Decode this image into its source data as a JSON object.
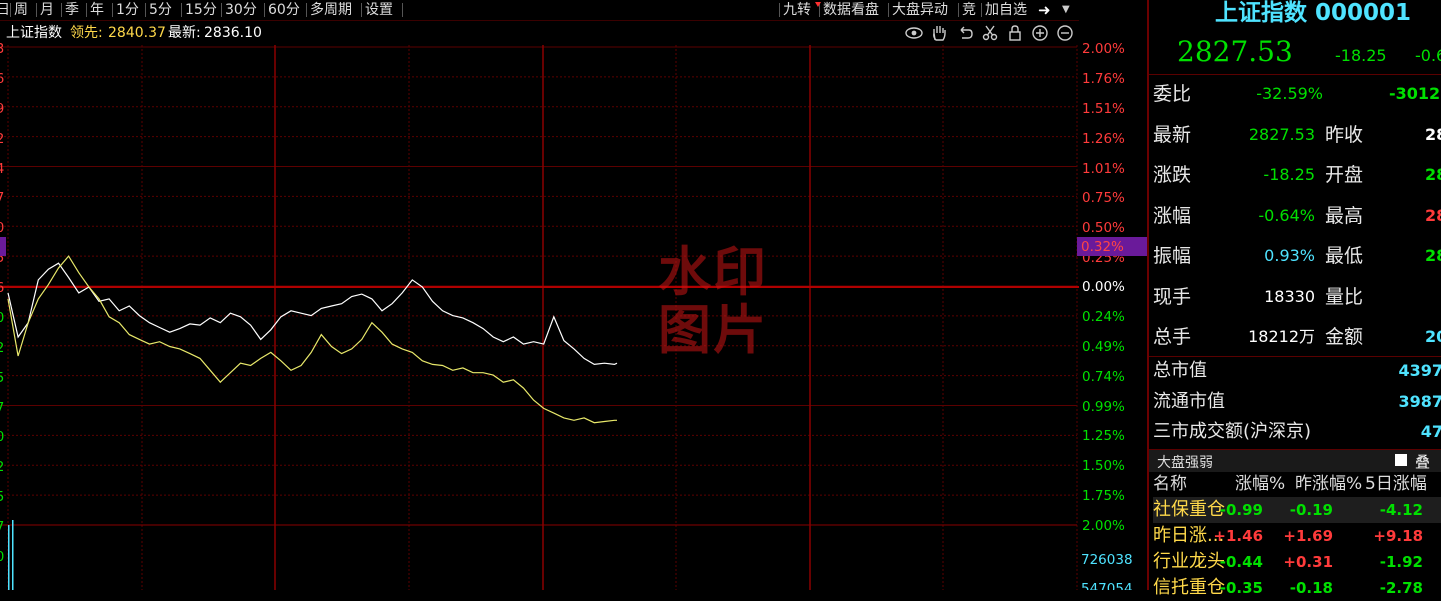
{
  "toolbar": {
    "left": [
      "日",
      "周",
      "月",
      "季",
      "年",
      "1分",
      "5分",
      "15分",
      "30分",
      "60分",
      "多周期",
      "设置"
    ],
    "right": [
      "九转",
      "数据看盘",
      "大盘异动",
      "竞",
      "加自选"
    ]
  },
  "info": {
    "name": "上证指数",
    "lead_label": "领先:",
    "lead_value": "2840.37",
    "latest_label": "最新:",
    "latest_value": "2836.10"
  },
  "y_axis": {
    "upper": [
      "2.00%",
      "1.76%",
      "1.51%",
      "1.26%",
      "1.01%",
      "0.75%",
      "0.50%",
      "0.25%"
    ],
    "highlight": "0.32%",
    "zero": "0.00%",
    "lower": [
      "0.24%",
      "0.49%",
      "0.74%",
      "0.99%",
      "1.25%",
      "1.50%",
      "1.75%",
      "2.00%"
    ],
    "volume_top": "726038",
    "volume_bottom": "547054"
  },
  "left_axis_digits": [
    "3",
    "6",
    "9",
    "2",
    "4",
    "7",
    "0",
    "5",
    "6",
    "0",
    "2",
    "5",
    "7",
    "0",
    "2",
    "5",
    "7",
    "0"
  ],
  "watermark": [
    "水印",
    "图片"
  ],
  "chart_data": {
    "type": "line",
    "title": "",
    "xlabel": "",
    "ylabel": "",
    "ylim": [
      -2.0,
      2.0
    ],
    "series": [
      {
        "name": "最新",
        "color": "#ffffff",
        "x": [
          0,
          4,
          8,
          12,
          16,
          20,
          24,
          28,
          32,
          36,
          40,
          44,
          48,
          52,
          56,
          60,
          64,
          68,
          72,
          76,
          80,
          84,
          88,
          92,
          96,
          100,
          104,
          108,
          112,
          116,
          120,
          124,
          128,
          132,
          136,
          140,
          144,
          148,
          152,
          156,
          160,
          164,
          168,
          172,
          176,
          180,
          184,
          188,
          192,
          196,
          200,
          204,
          208,
          212,
          216,
          220,
          224,
          228,
          232,
          236,
          240,
          241
        ],
        "values": [
          -0.05,
          -0.42,
          -0.3,
          0.06,
          0.15,
          0.2,
          0.08,
          -0.05,
          0.0,
          -0.12,
          -0.1,
          -0.2,
          -0.16,
          -0.24,
          -0.3,
          -0.34,
          -0.38,
          -0.35,
          -0.31,
          -0.32,
          -0.26,
          -0.3,
          -0.22,
          -0.25,
          -0.32,
          -0.44,
          -0.36,
          -0.25,
          -0.2,
          -0.22,
          -0.24,
          -0.18,
          -0.16,
          -0.14,
          -0.08,
          -0.06,
          -0.1,
          -0.2,
          -0.14,
          -0.05,
          0.06,
          0.0,
          -0.12,
          -0.2,
          -0.24,
          -0.26,
          -0.3,
          -0.35,
          -0.42,
          -0.46,
          -0.42,
          -0.48,
          -0.46,
          -0.48,
          -0.25,
          -0.45,
          -0.52,
          -0.6,
          -0.65,
          -0.64,
          -0.65,
          -0.64
        ]
      },
      {
        "name": "领先",
        "color": "#e8e86a",
        "x": [
          0,
          4,
          8,
          12,
          16,
          20,
          24,
          28,
          32,
          36,
          40,
          44,
          48,
          52,
          56,
          60,
          64,
          68,
          72,
          76,
          80,
          84,
          88,
          92,
          96,
          100,
          104,
          108,
          112,
          116,
          120,
          124,
          128,
          132,
          136,
          140,
          144,
          148,
          152,
          156,
          160,
          164,
          168,
          172,
          176,
          180,
          184,
          188,
          192,
          196,
          200,
          204,
          208,
          212,
          216,
          220,
          224,
          228,
          232,
          236,
          240,
          241
        ],
        "values": [
          -0.1,
          -0.58,
          -0.3,
          -0.1,
          0.02,
          0.16,
          0.26,
          0.12,
          0.0,
          -0.1,
          -0.25,
          -0.3,
          -0.4,
          -0.44,
          -0.48,
          -0.46,
          -0.5,
          -0.52,
          -0.56,
          -0.6,
          -0.7,
          -0.8,
          -0.72,
          -0.64,
          -0.66,
          -0.6,
          -0.55,
          -0.62,
          -0.7,
          -0.66,
          -0.55,
          -0.4,
          -0.5,
          -0.56,
          -0.52,
          -0.44,
          -0.3,
          -0.38,
          -0.48,
          -0.52,
          -0.55,
          -0.62,
          -0.65,
          -0.66,
          -0.7,
          -0.68,
          -0.72,
          -0.72,
          -0.74,
          -0.8,
          -0.78,
          -0.85,
          -0.95,
          -1.02,
          -1.06,
          -1.1,
          -1.12,
          -1.1,
          -1.14,
          -1.13,
          -1.12,
          -1.12
        ]
      }
    ]
  },
  "panel": {
    "title": "上证指数 000001",
    "price": "2827.53",
    "change": "-18.25",
    "change_pct_partial": "-0.6",
    "rows": [
      {
        "label": "委比",
        "val": "-32.59%",
        "val_color": "green",
        "val2": "-3012",
        "val2_color": "green"
      },
      {
        "label": "最新",
        "val": "2827.53",
        "val_color": "green",
        "label2": "昨收",
        "val2": "28",
        "val2_color": "white"
      },
      {
        "label": "涨跌",
        "val": "-18.25",
        "val_color": "green",
        "label2": "开盘",
        "val2": "28",
        "val2_color": "green"
      },
      {
        "label": "涨幅",
        "val": "-0.64%",
        "val_color": "green",
        "label2": "最高",
        "val2": "28",
        "val2_color": "red"
      },
      {
        "label": "振幅",
        "val": "0.93%",
        "val_color": "cyan",
        "label2": "最低",
        "val2": "28",
        "val2_color": "green"
      },
      {
        "label": "现手",
        "val": "18330",
        "val_color": "white",
        "label2": "量比",
        "val2": "",
        "val2_color": "white"
      },
      {
        "label": "总手",
        "val": "18212万",
        "val_color": "white",
        "label2": "金额",
        "val2": "20",
        "val2_color": "cyan"
      }
    ],
    "market": [
      {
        "label": "总市值",
        "val": "4397"
      },
      {
        "label": "流通市值",
        "val": "3987"
      },
      {
        "label": "三市成交额(沪深京)",
        "val": "47"
      }
    ],
    "strength_title": "大盘强弱",
    "overlay_label": "叠",
    "table_headers": [
      "名称",
      "涨幅%",
      "昨涨幅%",
      "5日涨幅"
    ],
    "table_rows": [
      {
        "name": "社保重仓",
        "c1": "-0.99",
        "c2": "-0.19",
        "c3": "-4.12"
      },
      {
        "name": "昨日涨...",
        "c1": "+1.46",
        "c2": "+1.69",
        "c3": "+9.18"
      },
      {
        "name": "行业龙头",
        "c1": "-0.44",
        "c2": "+0.31",
        "c3": "-1.92"
      },
      {
        "name": "信托重仓",
        "c1": "-0.35",
        "c2": "-0.18",
        "c3": "-2.78"
      }
    ]
  }
}
